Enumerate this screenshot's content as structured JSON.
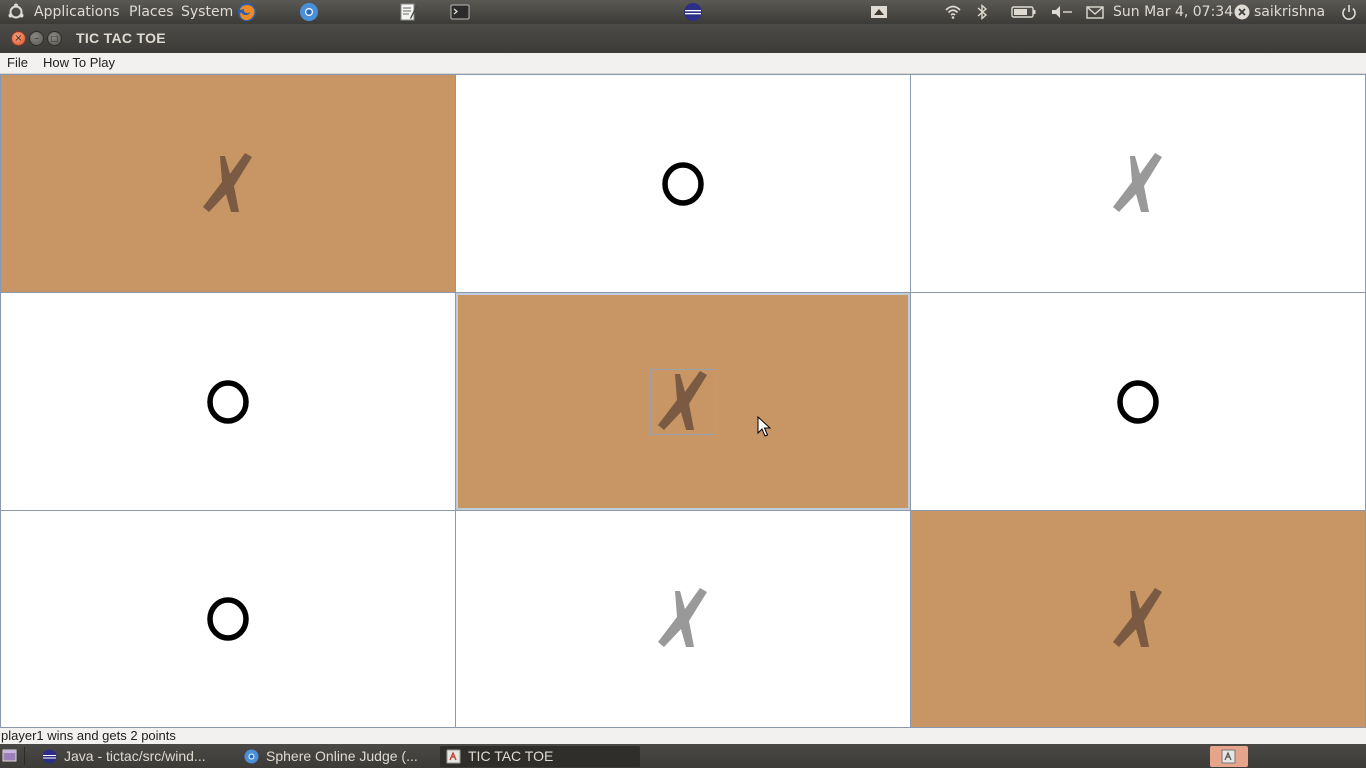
{
  "top_panel": {
    "menus": [
      "Applications",
      "Places",
      "System"
    ],
    "clock": "Sun Mar  4, 07:34",
    "user": "saikrishna",
    "launchers": [
      "firefox-icon",
      "chromium-icon",
      "text-editor-icon",
      "terminal-icon",
      "eclipse-icon"
    ],
    "tray_icons": [
      "screen-icon",
      "wifi-icon",
      "bluetooth-icon",
      "battery-icon",
      "volume-icon",
      "mail-icon",
      "user-status-icon",
      "power-icon"
    ]
  },
  "window": {
    "title": "TIC TAC TOE"
  },
  "menubar": {
    "items": [
      "File",
      "How To Play"
    ]
  },
  "board": {
    "cells": [
      {
        "mark": "X",
        "winning": true
      },
      {
        "mark": "O",
        "winning": false
      },
      {
        "mark": "X",
        "winning": false
      },
      {
        "mark": "O",
        "winning": false
      },
      {
        "mark": "X",
        "winning": true,
        "focused": true
      },
      {
        "mark": "O",
        "winning": false
      },
      {
        "mark": "O",
        "winning": false
      },
      {
        "mark": "X",
        "winning": false
      },
      {
        "mark": "X",
        "winning": true
      }
    ],
    "colors": {
      "win_bg": "#c89664",
      "x_win": "#7a5a42",
      "x_normal": "#999999",
      "o": "#000000"
    }
  },
  "status": {
    "text": "player1 wins and gets  2  points"
  },
  "taskbar": {
    "tasks": [
      {
        "label": "Java - tictac/src/wind...",
        "icon": "eclipse-icon"
      },
      {
        "label": "Sphere Online Judge (...",
        "icon": "chromium-icon"
      },
      {
        "label": "TIC TAC TOE",
        "icon": "java-icon",
        "active": true
      }
    ]
  }
}
